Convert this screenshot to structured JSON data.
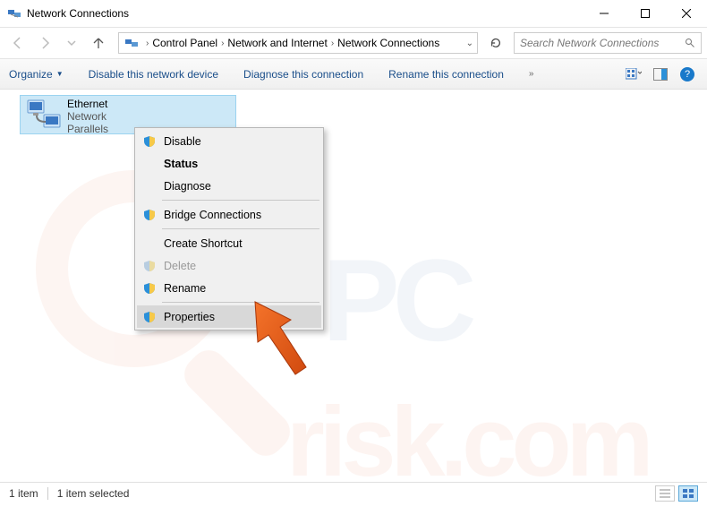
{
  "window": {
    "title": "Network Connections"
  },
  "breadcrumb": {
    "parts": [
      "Control Panel",
      "Network and Internet",
      "Network Connections"
    ]
  },
  "search": {
    "placeholder": "Search Network Connections"
  },
  "toolbar": {
    "organize": "Organize",
    "disable": "Disable this network device",
    "diagnose": "Diagnose this connection",
    "rename": "Rename this connection"
  },
  "item": {
    "name": "Ethernet",
    "status": "Network",
    "device": "Parallels"
  },
  "menu": {
    "disable": "Disable",
    "status": "Status",
    "diagnose": "Diagnose",
    "bridge": "Bridge Connections",
    "shortcut": "Create Shortcut",
    "delete": "Delete",
    "rename": "Rename",
    "properties": "Properties"
  },
  "statusbar": {
    "count": "1 item",
    "selected": "1 item selected"
  }
}
